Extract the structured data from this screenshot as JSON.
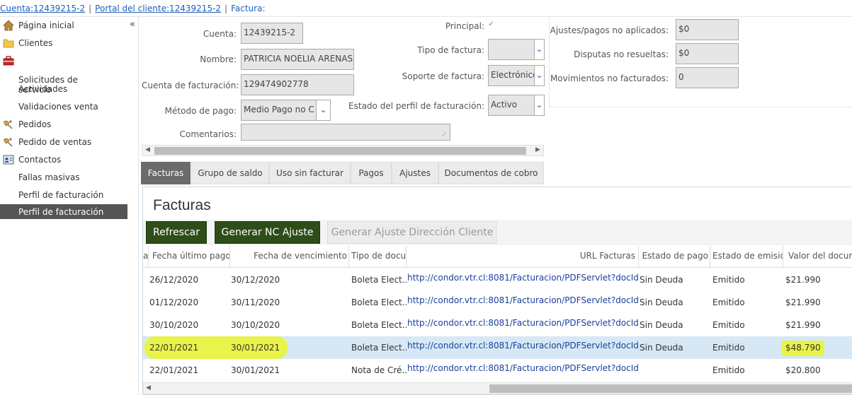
{
  "breadcrumb": {
    "account": "Cuenta:12439215-2",
    "portal": "Portal del cliente:12439215-2",
    "current": "Factura:"
  },
  "sidebar": {
    "items": [
      {
        "label": "Página inicial",
        "icon": "home-icon"
      },
      {
        "label": "Clientes",
        "icon": "folder-icon"
      },
      {
        "label": "Solicitudes de\nservicio",
        "icon": "toolbox-icon"
      },
      {
        "label": "Actividades",
        "icon": ""
      },
      {
        "label": "Validaciones venta",
        "icon": ""
      },
      {
        "label": "Pedidos",
        "icon": "satellite-icon"
      },
      {
        "label": "Pedido de ventas",
        "icon": "satellite-icon"
      },
      {
        "label": "Contactos",
        "icon": "contact-card-icon"
      },
      {
        "label": "Fallas masivas",
        "icon": ""
      },
      {
        "label": "Perfil de facturación",
        "icon": ""
      },
      {
        "label": "Perfil de facturación",
        "icon": ""
      }
    ],
    "selected_index": 10
  },
  "form": {
    "cuenta_label": "Cuenta:",
    "cuenta_value": "12439215-2",
    "nombre_label": "Nombre:",
    "nombre_value": "PATRICIA NOELIA ARENAS",
    "cuenta_fact_label": "Cuenta de facturación:",
    "cuenta_fact_value": "129474902778",
    "metodo_label": "Método de pago:",
    "metodo_value": "Medio Pago no C",
    "comentarios_label": "Comentarios:",
    "comentarios_value": "",
    "principal_label": "Principal:",
    "principal_checked": true,
    "tipo_factura_label": "Tipo de factura:",
    "tipo_factura_value": "",
    "soporte_label": "Soporte de factura:",
    "soporte_value": "Electrónico",
    "estado_perfil_label": "Estado del perfil de facturación:",
    "estado_perfil_value": "Activo",
    "ajustes_label": "Ajustes/pagos no aplicados:",
    "ajustes_value": "$0",
    "disputas_label": "Disputas no resueltas:",
    "disputas_value": "$0",
    "movimientos_label": "Movimientos no facturados:",
    "movimientos_value": "0"
  },
  "tabs": [
    "Facturas",
    "Grupo de saldo",
    "Uso sin facturar",
    "Pagos",
    "Ajustes",
    "Documentos de cobro"
  ],
  "active_tab": 0,
  "panel": {
    "title": "Facturas",
    "buttons": {
      "refresh": "Refrescar",
      "generate_nc": "Generar NC Ajuste",
      "generate_address": "Generar Ajuste Dirección Cliente"
    }
  },
  "table": {
    "columns": [
      "a",
      "Fecha último pago",
      "Fecha de vencimiento",
      "Tipo de docu",
      "URL Facturas",
      "Estado de pago",
      "Estado de emisió",
      "Valor del docum"
    ],
    "rows": [
      {
        "fecha_pago": "26/12/2020",
        "fecha_venc": "30/12/2020",
        "tipo": "Boleta Elect...",
        "url": "http://condor.vtr.cl:8081/Facturacion/PDFServlet?docId",
        "estado_pago": "Sin Deuda",
        "estado_emision": "Emitido",
        "valor": "$21.990"
      },
      {
        "fecha_pago": "01/12/2020",
        "fecha_venc": "30/11/2020",
        "tipo": "Boleta Elect...",
        "url": "http://condor.vtr.cl:8081/Facturacion/PDFServlet?docId",
        "estado_pago": "Sin Deuda",
        "estado_emision": "Emitido",
        "valor": "$21.990"
      },
      {
        "fecha_pago": "30/10/2020",
        "fecha_venc": "30/10/2020",
        "tipo": "Boleta Elect...",
        "url": "http://condor.vtr.cl:8081/Facturacion/PDFServlet?docId",
        "estado_pago": "Sin Deuda",
        "estado_emision": "Emitido",
        "valor": "$21.990"
      },
      {
        "fecha_pago": "22/01/2021",
        "fecha_venc": "30/01/2021",
        "tipo": "Boleta Elect...",
        "url": "http://condor.vtr.cl:8081/Facturacion/PDFServlet?docId",
        "estado_pago": "Sin Deuda",
        "estado_emision": "Emitido",
        "valor": "$48.790"
      },
      {
        "fecha_pago": "22/01/2021",
        "fecha_venc": "30/01/2021",
        "tipo": "Nota de Cré...",
        "url": "http://condor.vtr.cl:8081/Facturacion/PDFServlet?docId",
        "estado_pago": "",
        "estado_emision": "Emitido",
        "valor": "$20.800"
      }
    ],
    "selected_row": 3
  },
  "colors": {
    "selected_row": "#d6e8f5",
    "highlight": "#ecf52a",
    "dark_button": "#2e4d18",
    "link": "#1f5fb8",
    "sidebar_selected": "#555555"
  }
}
